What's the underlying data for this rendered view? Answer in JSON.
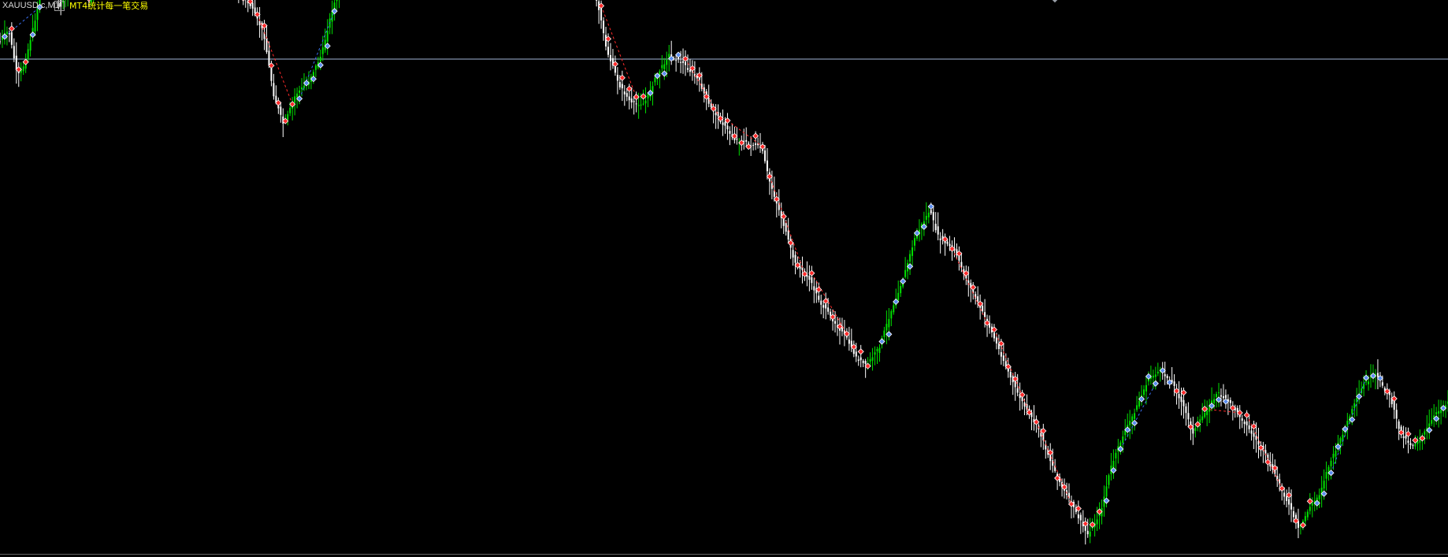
{
  "header": {
    "symbol": "XAUUSD.c,M1",
    "plus_label": "+",
    "indicator": "MT4统计每一笔交易"
  },
  "colors": {
    "background": "#000000",
    "bull_candle": "#00e000",
    "bear_candle": "#ffffff",
    "sell_marker": "#ff2a2a",
    "buy_marker": "#5b8def",
    "buy_line": "#3a6ff0",
    "sell_line": "#ff2a2a",
    "horizontal_line": "#9fb3d6",
    "axis": "#c8c8c8",
    "header_text": "#d8d8d8",
    "indicator_text": "#ffff00"
  },
  "chart_data": {
    "type": "candlestick",
    "title": "",
    "series": [
      {
        "points": [
          [
            0,
            0.8
          ],
          [
            0.3,
            0.95
          ],
          [
            0.6,
            1.05
          ],
          [
            0.9,
            0.55
          ],
          [
            1.2,
            0.0
          ],
          [
            1.7,
            0.3
          ],
          [
            2.5,
            1.4
          ],
          [
            3.3,
            2.9
          ],
          [
            4.2,
            1.6
          ],
          [
            5.2,
            2.6
          ],
          [
            6.1,
            1.7
          ],
          [
            7.0,
            2.2
          ],
          [
            8.0,
            2.8
          ],
          [
            8.8,
            4.3
          ],
          [
            9.4,
            5.5
          ],
          [
            10.2,
            5.8
          ],
          [
            11.0,
            4.9
          ],
          [
            11.7,
            3.7
          ],
          [
            12.3,
            3.9
          ],
          [
            13.0,
            2.9
          ],
          [
            13.9,
            2.5
          ],
          [
            14.8,
            3.1
          ],
          [
            15.6,
            2.5
          ],
          [
            16.5,
            1.9
          ],
          [
            17.3,
            1.6
          ],
          [
            18.2,
            1.0
          ],
          [
            18.9,
            -0.4
          ],
          [
            19.6,
            -1.1
          ],
          [
            20.4,
            -0.4
          ],
          [
            21.3,
            -0.1
          ],
          [
            22.2,
            0.5
          ],
          [
            23.0,
            1.6
          ],
          [
            23.9,
            2.2
          ],
          [
            24.9,
            2.6
          ],
          [
            25.7,
            3.4
          ],
          [
            26.7,
            4.1
          ],
          [
            27.6,
            4.0
          ],
          [
            28.3,
            3.5
          ],
          [
            28.8,
            2.6
          ],
          [
            29.4,
            3.2
          ],
          [
            30.2,
            4.5
          ],
          [
            31.1,
            4.8
          ],
          [
            31.6,
            4.6
          ],
          [
            32.4,
            4.3
          ],
          [
            33.2,
            4.7
          ],
          [
            34.1,
            5.2
          ],
          [
            35.0,
            5.5
          ],
          [
            35.6,
            5.6
          ],
          [
            36.1,
            5.1
          ],
          [
            36.7,
            4.4
          ],
          [
            37.5,
            4.3
          ],
          [
            38.6,
            3.8
          ],
          [
            39.6,
            3.2
          ],
          [
            40.5,
            2.4
          ],
          [
            41.3,
            1.6
          ],
          [
            41.9,
            0.6
          ],
          [
            42.8,
            -0.2
          ],
          [
            43.6,
            -0.6
          ],
          [
            44.5,
            -0.6
          ],
          [
            45.3,
            0.0
          ],
          [
            46.2,
            0.5
          ],
          [
            47.2,
            0.3
          ],
          [
            48.3,
            -0.1
          ],
          [
            48.9,
            -0.6
          ],
          [
            49.8,
            -1.0
          ],
          [
            50.7,
            -1.4
          ],
          [
            51.7,
            -1.5
          ],
          [
            52.6,
            -1.6
          ],
          [
            53.1,
            -2.3
          ],
          [
            54.0,
            -3.2
          ],
          [
            54.9,
            -4.2
          ],
          [
            55.8,
            -4.5
          ],
          [
            56.7,
            -5.1
          ],
          [
            57.6,
            -5.5
          ],
          [
            58.5,
            -5.9
          ],
          [
            59.1,
            -6.3
          ],
          [
            59.8,
            -6.5
          ],
          [
            60.7,
            -6.1
          ],
          [
            61.5,
            -5.3
          ],
          [
            62.4,
            -4.5
          ],
          [
            63.2,
            -3.6
          ],
          [
            64.2,
            -3.0
          ],
          [
            64.8,
            -3.6
          ],
          [
            65.9,
            -3.9
          ],
          [
            66.8,
            -4.6
          ],
          [
            67.4,
            -5.0
          ],
          [
            68.3,
            -5.6
          ],
          [
            69.2,
            -6.3
          ],
          [
            70.1,
            -7.0
          ],
          [
            70.9,
            -7.5
          ],
          [
            71.7,
            -7.9
          ],
          [
            72.5,
            -8.6
          ],
          [
            73.3,
            -9.2
          ],
          [
            74.3,
            -9.8
          ],
          [
            75.1,
            -10.3
          ],
          [
            76.0,
            -9.8
          ],
          [
            76.7,
            -8.8
          ],
          [
            77.5,
            -8.1
          ],
          [
            78.4,
            -7.5
          ],
          [
            79.3,
            -6.8
          ],
          [
            80.1,
            -6.6
          ],
          [
            81.0,
            -6.9
          ],
          [
            81.7,
            -7.4
          ],
          [
            82.4,
            -8.0
          ],
          [
            83.3,
            -7.5
          ],
          [
            84.1,
            -7.1
          ],
          [
            85.1,
            -7.4
          ],
          [
            86.0,
            -7.8
          ],
          [
            86.8,
            -8.2
          ],
          [
            87.5,
            -8.6
          ],
          [
            88.4,
            -9.2
          ],
          [
            89.1,
            -9.7
          ],
          [
            89.7,
            -10.2
          ],
          [
            90.4,
            -9.7
          ],
          [
            91.1,
            -9.4
          ],
          [
            91.7,
            -8.8
          ],
          [
            92.5,
            -8.2
          ],
          [
            93.5,
            -7.4
          ],
          [
            94.2,
            -6.9
          ],
          [
            95.0,
            -6.7
          ],
          [
            96.0,
            -7.2
          ],
          [
            96.7,
            -8.0
          ],
          [
            97.5,
            -8.3
          ],
          [
            98.2,
            -8.1
          ],
          [
            99.1,
            -7.6
          ],
          [
            100.0,
            -7.3
          ]
        ]
      }
    ]
  }
}
